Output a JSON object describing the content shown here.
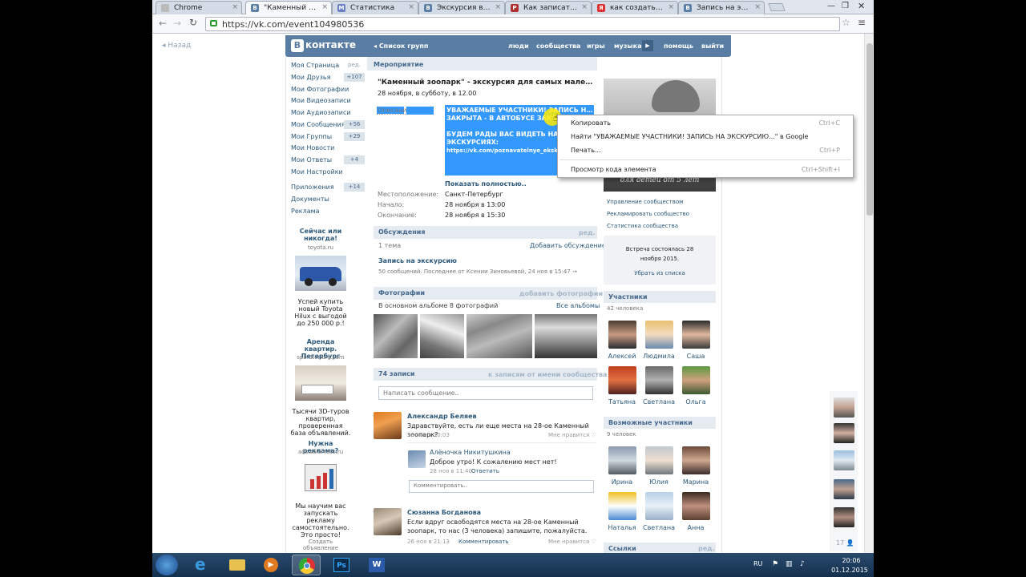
{
  "browser": {
    "tabs": [
      {
        "label": "Chrome",
        "fav": "",
        "color": "#aaa"
      },
      {
        "label": "\"Каменный зоопарк\"",
        "fav": "B",
        "color": "#5b7fa6"
      },
      {
        "label": "Статистика",
        "fav": "M",
        "color": "#6b7fc6"
      },
      {
        "label": "Экскурсия в Пушкин",
        "fav": "B",
        "color": "#5b7fa6"
      },
      {
        "label": "Как записать видео",
        "fav": "P",
        "color": "#b03030"
      },
      {
        "label": "как создать вики-",
        "fav": "Я",
        "color": "#e03030"
      },
      {
        "label": "Запись на экскурсию",
        "fav": "B",
        "color": "#5b7fa6"
      }
    ],
    "url": "https://vk.com/event104980536"
  },
  "vk": {
    "logo": "контакте",
    "groups_link": "Список групп",
    "nav": [
      "люди",
      "сообщества",
      "игры",
      "музыка",
      "помощь",
      "выйти"
    ],
    "back": "Назад"
  },
  "sidebar": {
    "items": [
      {
        "label": "Моя Страница",
        "count": "ред."
      },
      {
        "label": "Мои Друзья",
        "count": "+107"
      },
      {
        "label": "Мои Фотографии",
        "count": ""
      },
      {
        "label": "Мои Видеозаписи",
        "count": ""
      },
      {
        "label": "Мои Аудиозаписи",
        "count": ""
      },
      {
        "label": "Мои Сообщения",
        "count": "+56"
      },
      {
        "label": "Мои Группы",
        "count": "+29"
      },
      {
        "label": "Мои Новости",
        "count": ""
      },
      {
        "label": "Мои Ответы",
        "count": "+4"
      },
      {
        "label": "Мои Настройки",
        "count": ""
      }
    ],
    "items2": [
      {
        "label": "Приложения",
        "count": "+14"
      },
      {
        "label": "Документы",
        "count": ""
      },
      {
        "label": "Реклама",
        "count": ""
      }
    ],
    "ads": [
      {
        "title": "Сейчас или никогда!",
        "site": "toyota.ru",
        "text": "Успей купить новый Toyota Hilux с выгодой до 250 000 р.!"
      },
      {
        "title": "Аренда квартир. Петербург",
        "site": "spb.dterium.com",
        "text": "Тысячи 3D-туров квартир, проверенная база объявлений."
      },
      {
        "title": "Нужна реклама?",
        "site": "ads.solomoto.ru",
        "text": "Мы научим вас запускать рекламу самостоятельно. Это просто!"
      }
    ],
    "create_ad": "Создать объявление"
  },
  "event": {
    "section": "Мероприятие",
    "title": "\"Каменный зоопарк\" - экскурсия для самых маленьк",
    "date": "28 ноября, в субботу, в 12.00",
    "desc_label": "Описание:",
    "desc_lines": [
      "УВАЖАЕМЫЕ УЧАСТНИКИ! ЗАПИСЬ НА ЭКСКУРСИЮ",
      "ЗАКРЫТА - В АВТОБУСЕ ЗАКОНЧИЛИСЬ",
      "",
      "БУДЕМ РАДЫ ВАС ВИДЕТЬ НА ДРУГИХ",
      "ЭКСКУРСИЯХ:",
      "https://vk.com/poznavatelnye_ekskursii"
    ],
    "show_full": "Показать полностью..",
    "location_label": "Местоположение:",
    "location": "Санкт-Петербург",
    "start_label": "Начало:",
    "start": "28 ноября в 13:00",
    "end_label": "Окончание:",
    "end": "28 ноября в 15:30"
  },
  "discussions": {
    "title": "Обсуждения",
    "edit": "ред.",
    "count": "1 тема",
    "add": "Добавить обсуждение",
    "topic": "Запись на экскурсию",
    "topic_meta": "50 сообщений. Последнее от Ксении Зиновьевой, 24 ноя в 15:47 →"
  },
  "photos": {
    "title": "Фотографии",
    "add": "добавить фотографии",
    "sub": "В основном альбоме 8 фотографий",
    "all": "Все альбомы"
  },
  "wall": {
    "count": "74 записи",
    "link": "к записям от имени сообщества",
    "placeholder": "Написать сообщение..",
    "posts": [
      {
        "name": "Александр Беляев",
        "text": "Здравствуйте, есть ли еще места на 28-ое Каменный зоопарк?",
        "meta": "28 ноя в 10:03",
        "like": "Мне нравится"
      },
      {
        "name": "Сюзанна Богданова",
        "text": "Если вдруг освободятся места на 28-ое Каменный зоопарк, то нас (3 человека) запишите, пожалуйста.",
        "meta": "26 ноя в 21:13",
        "comment": "Комментировать",
        "like": "Мне нравится"
      }
    ],
    "reply": {
      "name": "Алёночка Никитушкина",
      "text": "Доброе утро! К сожалению мест нет!",
      "meta": "28 ноя в 11:40",
      "answer": "Ответить"
    },
    "comment_placeholder": "Комментировать.."
  },
  "right": {
    "banner_text": "для детей от 5 лет",
    "links": [
      "Управление сообществом",
      "Рекламировать сообщество",
      "Статистика сообщества"
    ],
    "held": "Встреча состоялась 28 ноября 2015.",
    "remove": "Убрать из списка",
    "members_title": "Участники",
    "members_count": "42 человека",
    "members": [
      "Алексей",
      "Людмила",
      "Саша",
      "Татьяна",
      "Светлана",
      "Ольга"
    ],
    "possible_title": "Возможные участники",
    "possible_count": "9 человек",
    "possible": [
      "Ирина",
      "Юлия",
      "Марина",
      "Наталья",
      "Светлана",
      "Анна"
    ],
    "links_title": "Ссылки",
    "links_edit": "ред."
  },
  "chat": {
    "count": "17"
  },
  "context_menu": {
    "items": [
      {
        "label": "Копировать",
        "key": "Ctrl+C"
      },
      {
        "label": "Найти \"УВАЖАЕМЫЕ УЧАСТНИКИ! ЗАПИСЬ НА ЭКСКУРСИЮ...\" в Google",
        "key": ""
      },
      {
        "label": "Печать...",
        "key": "Ctrl+P"
      },
      {
        "label": "Просмотр кода элемента",
        "key": "Ctrl+Shift+I"
      }
    ]
  },
  "taskbar": {
    "lang": "RU",
    "time": "20:06",
    "date": "01.12.2015"
  }
}
